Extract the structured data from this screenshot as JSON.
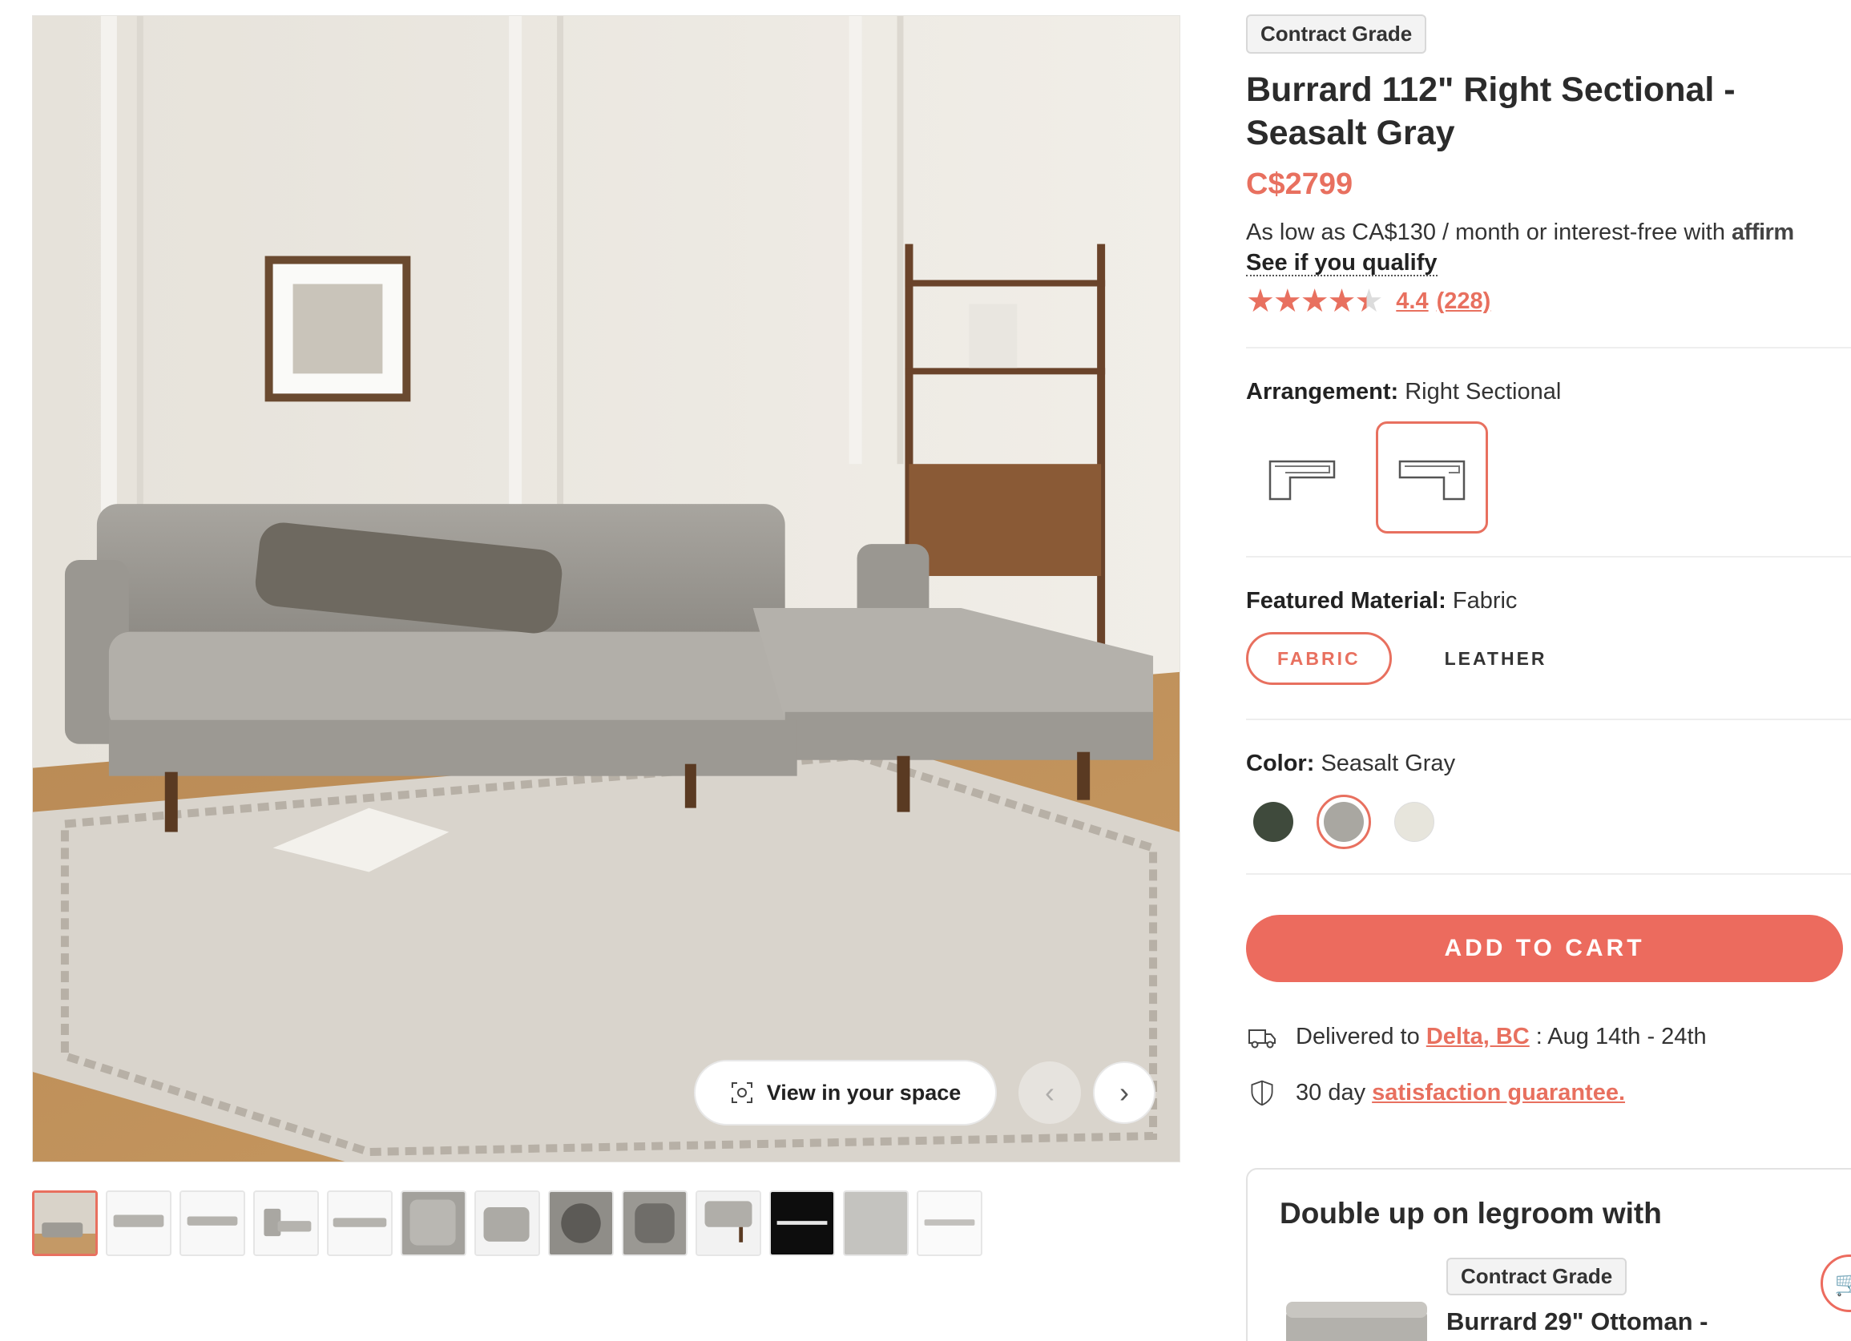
{
  "gallery": {
    "view_in_space_label": "View in your space",
    "prev_icon": "chevron-left-icon",
    "next_icon": "chevron-right-icon",
    "thumbnail_count": 13,
    "active_thumbnail": 1
  },
  "product": {
    "badge": "Contract Grade",
    "title": "Burrard 112\" Right Sectional - Seasalt Gray",
    "price": "C$2799",
    "finance_text": "As low as CA$130 / month or interest-free with",
    "finance_brand": "affirm",
    "qualify_link": "See if you qualify",
    "rating_value": "4.4",
    "rating_count": "(228)",
    "rating_stars": 4.4
  },
  "arrangement": {
    "label": "Arrangement:",
    "value": "Right Sectional",
    "options": [
      "Left Sectional",
      "Right Sectional"
    ],
    "selected": "Right Sectional"
  },
  "material": {
    "label": "Featured Material:",
    "value": "Fabric",
    "options": [
      "FABRIC",
      "LEATHER"
    ],
    "selected": "FABRIC"
  },
  "color": {
    "label": "Color:",
    "value": "Seasalt Gray",
    "swatches": [
      {
        "name": "dark green",
        "hex": "#3f4a3c"
      },
      {
        "name": "Seasalt Gray",
        "hex": "#a9a7a1"
      },
      {
        "name": "cream",
        "hex": "#e7e5dc"
      }
    ],
    "selected_index": 1
  },
  "cart": {
    "label": "ADD TO CART"
  },
  "delivery": {
    "prefix": "Delivered to",
    "location": "Delta, BC",
    "dates": ": Aug 14th - 24th"
  },
  "guarantee": {
    "prefix": "30 day",
    "link": "satisfaction guarantee."
  },
  "upsell": {
    "heading": "Double up on legroom with",
    "badge": "Contract Grade",
    "product": "Burrard 29\" Ottoman -"
  },
  "colors": {
    "accent": "#e8705f",
    "button": "#ec6b5e",
    "text": "#222222"
  }
}
